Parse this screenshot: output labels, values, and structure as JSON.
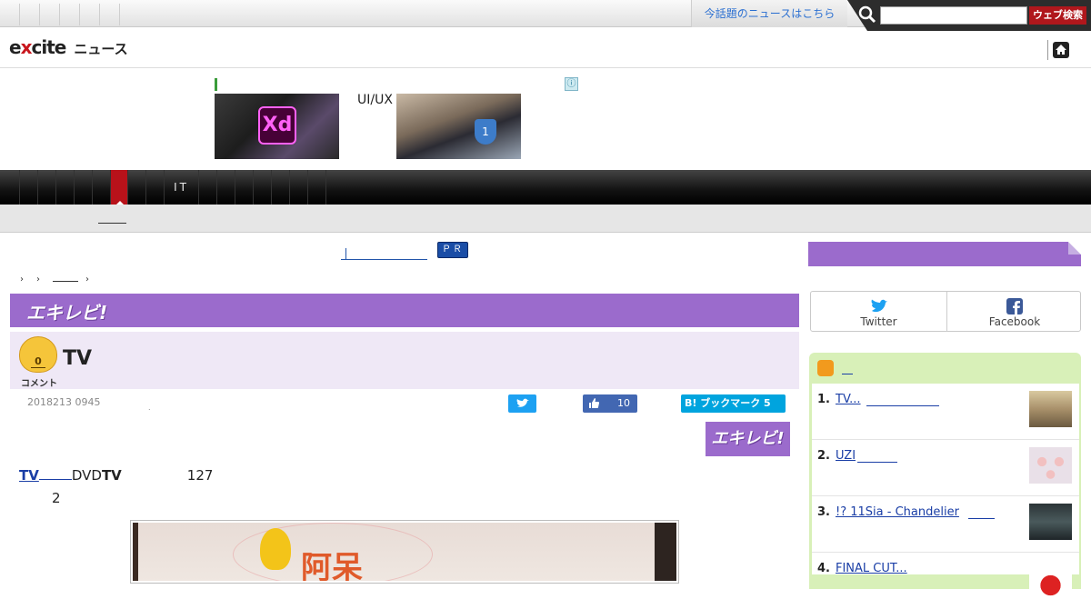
{
  "topbar": {
    "news_link": "今話題のニュースはこちら",
    "search_placeholder": "",
    "search_button": "ウェブ検索"
  },
  "header": {
    "logo_part1": "e",
    "logo_x": "x",
    "logo_part2": "cite",
    "logo_sub": "ニュース"
  },
  "ad": {
    "label": "UI/UX",
    "xd_text": "Xd",
    "info": "ⓘ"
  },
  "nav": {
    "items": [
      "",
      "",
      "",
      "",
      "",
      "",
      "",
      "",
      "",
      "IT",
      "",
      "",
      "",
      "",
      "",
      "",
      ""
    ],
    "active_index": 6
  },
  "pr": {
    "badge": "ＰＲ"
  },
  "section": {
    "brand": "エキレビ!"
  },
  "article": {
    "comment_count": "0",
    "comment_label": "コメント",
    "title": "TV",
    "date": "2018213 0945",
    "dot": ".",
    "like_count": "10",
    "hatena": "B! ブックマーク 5",
    "brand_badge": "エキレビ!",
    "body_tv": "TV",
    "body_dvd": "DVD",
    "body_tv2": "TV",
    "body_num": "127",
    "body_line2": "2",
    "photo_text": "阿呆"
  },
  "sidebar": {
    "share_twitter": "Twitter",
    "share_facebook": "Facebook",
    "ranking": [
      {
        "num": "1.",
        "title": "TV..."
      },
      {
        "num": "2.",
        "title": "UZI"
      },
      {
        "num": "3.",
        "title": "!? 11Sia - Chandelier"
      },
      {
        "num": "4.",
        "title": "FINAL CUT..."
      }
    ]
  },
  "colors": {
    "accent": "#9b6bcc",
    "nav_active": "#b8121a",
    "link": "#1a3ea6",
    "twitter": "#1da1f2",
    "facebook": "#4267b2",
    "hatena": "#00a4de"
  }
}
